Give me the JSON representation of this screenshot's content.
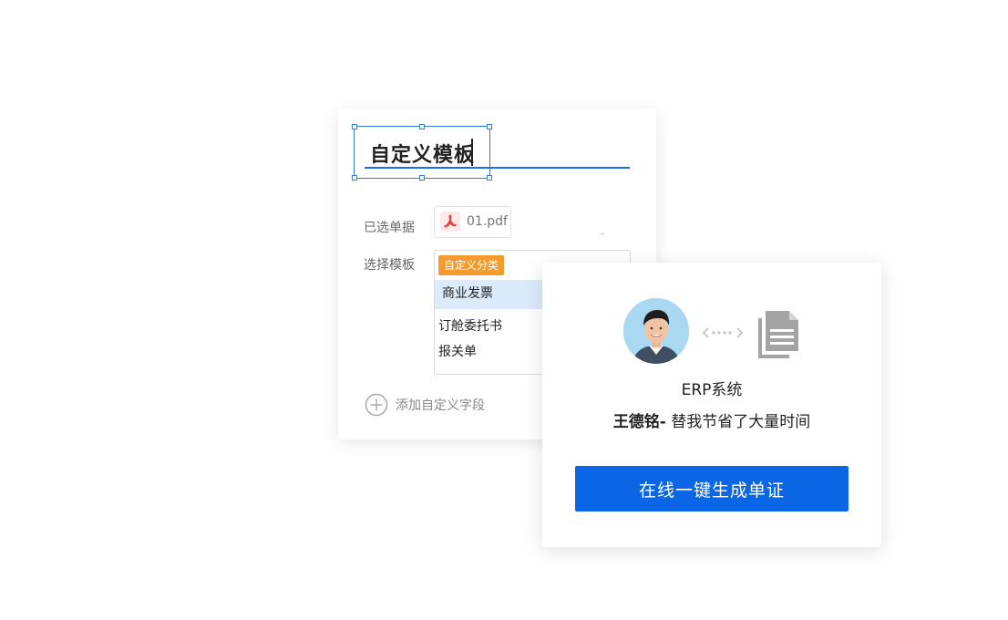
{
  "template_editor": {
    "title": "自定义模板",
    "selected_docs_label": "已选单据",
    "file_name": "01.pdf",
    "file_icon": "pdf-icon",
    "choose_template_label": "选择模板",
    "category_tag": "自定义分类",
    "options": [
      "商业发票",
      "订舱委托书",
      "报关单"
    ],
    "selected_option": "商业发票",
    "add_field_label": "添加自定义字段",
    "accent_color": "#1a6fe0",
    "tag_color": "#f59a2f"
  },
  "testimonial": {
    "system_label": "ERP系统",
    "person_name": "王德铭-",
    "quote": " 替我节省了大量时间",
    "cta_label": "在线一键生成单证",
    "cta_color": "#0a66e4"
  }
}
